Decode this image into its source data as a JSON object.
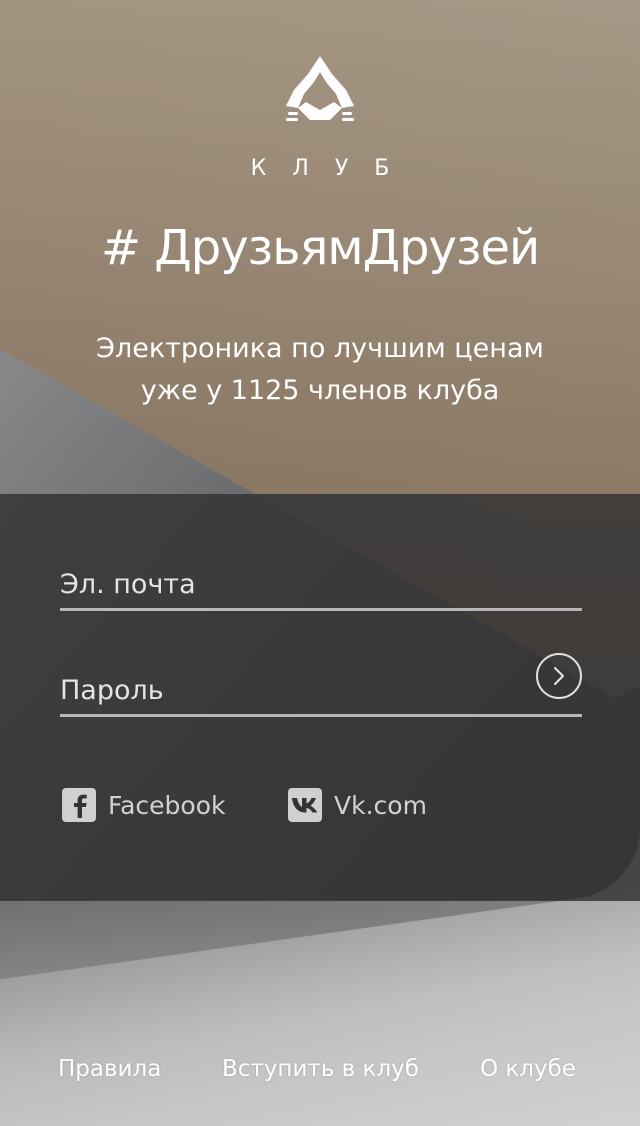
{
  "hero": {
    "club_label": "КЛУБ",
    "hashtag": "# ДрузьямДрузей",
    "tagline_line1": "Электроника по лучшим ценам",
    "tagline_line2": "уже у 1125 членов клуба"
  },
  "login": {
    "email_placeholder": "Эл. почта",
    "password_placeholder": "Пароль",
    "submit_icon": "chevron-right-icon"
  },
  "social": {
    "facebook_label": "Facebook",
    "facebook_icon": "facebook-icon",
    "vk_label": "Vk.com",
    "vk_icon": "vk-icon"
  },
  "footer": {
    "rules": "Правила",
    "join": "Вступить в клуб",
    "about": "О клубе"
  },
  "colors": {
    "panel": "#343436",
    "accent_text": "#ffffff",
    "field_underline": "#b7b7b9"
  }
}
